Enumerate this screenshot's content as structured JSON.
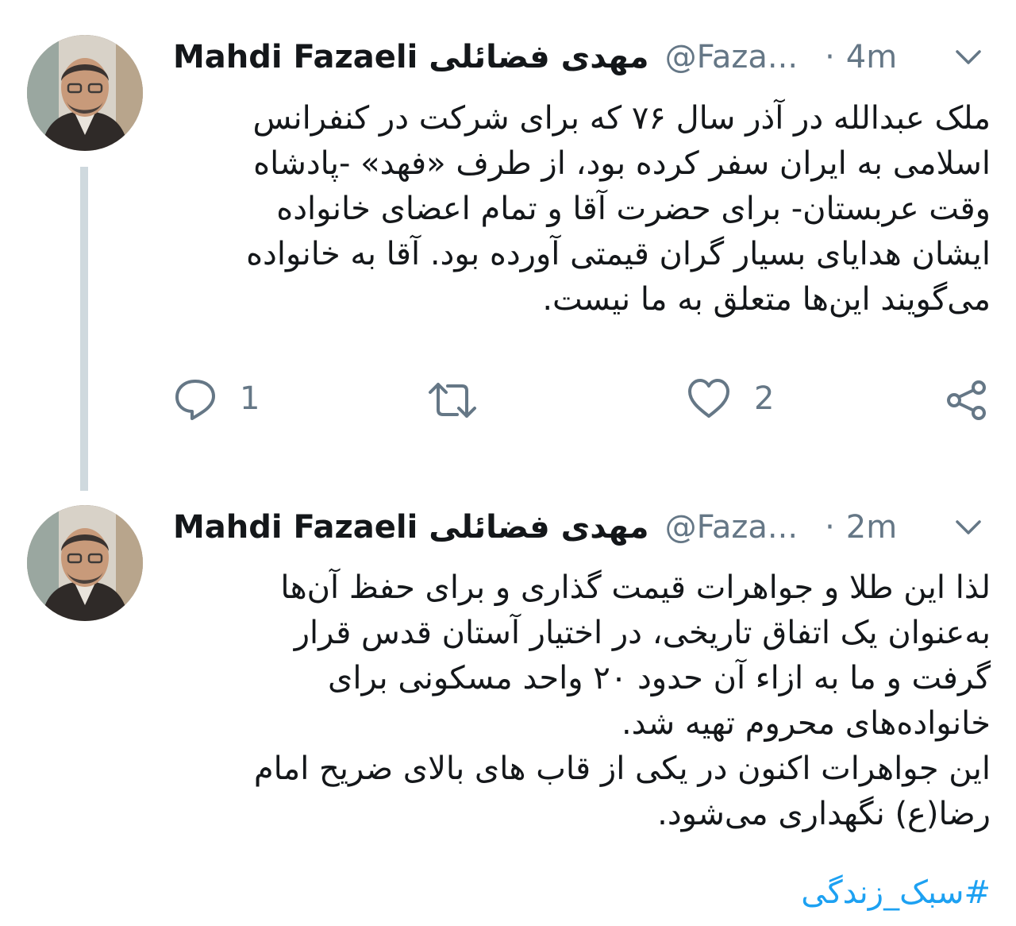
{
  "tweets": [
    {
      "display_name": "Mahdi Fazaeli مهدی فضائلی",
      "handle": "@Faza...",
      "separator": "·",
      "time": "4m",
      "text": "ملک عبدالله در آذر سال ۷۶ که برای شرکت در کنفرانس\nاسلامی به ایران سفر کرده بود، از طرف «فهد» -پادشاه\nوقت عربستان- برای حضرت آقا و تمام اعضای خانواده\nایشان هدایای بسیار گران قیمتی آورده بود. آقا به خانواده\nمی‌گویند این‌ها متعلق به ما نیست.",
      "replies": "1",
      "likes": "2"
    },
    {
      "display_name": "Mahdi Fazaeli مهدی فضائلی",
      "handle": "@Faza...",
      "separator": "·",
      "time": "2m",
      "text": "لذا این طلا و جواهرات قیمت گذاری و برای حفظ آن‌ها\nبه‌عنوان یک اتفاق تاریخی، در اختیار آستان قدس قرار\nگرفت و ما به ازاء آن حدود ۲۰ واحد مسکونی برای\nخانواده‌های محروم تهیه شد.\nاین جواهرات اکنون در یکی از قاب های بالای ضریح امام\nرضا(ع) نگهداری می‌شود.",
      "hashtag": "#سبک_زندگی"
    }
  ],
  "icons": [
    "chevron-down-icon",
    "reply-icon",
    "retweet-icon",
    "like-icon",
    "share-icon"
  ],
  "colors": {
    "text": "#14171a",
    "secondary": "#657786",
    "link": "#1da1f2",
    "thread_line": "#cfd9de"
  }
}
